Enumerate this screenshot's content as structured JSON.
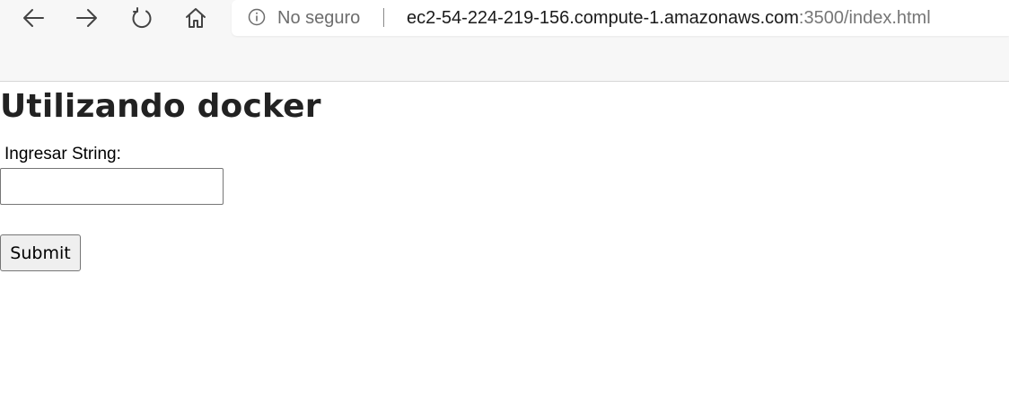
{
  "browser": {
    "nav_buttons": [
      "back-arrow-icon",
      "forward-arrow-icon",
      "refresh-icon",
      "home-icon"
    ],
    "security_label": "No seguro",
    "url_host": "ec2-54-224-219-156.compute-1.amazonaws.com",
    "url_path": ":3500/index.html"
  },
  "page": {
    "title": "Utilizando docker",
    "form": {
      "label": "Ingresar String:",
      "input_value": "",
      "input_placeholder": "",
      "submit_label": "Submit"
    }
  },
  "colors": {
    "browser_bar": "#f7f7f7",
    "title_text": "#222222",
    "button_bg": "#efefef",
    "url_muted": "#767676"
  }
}
